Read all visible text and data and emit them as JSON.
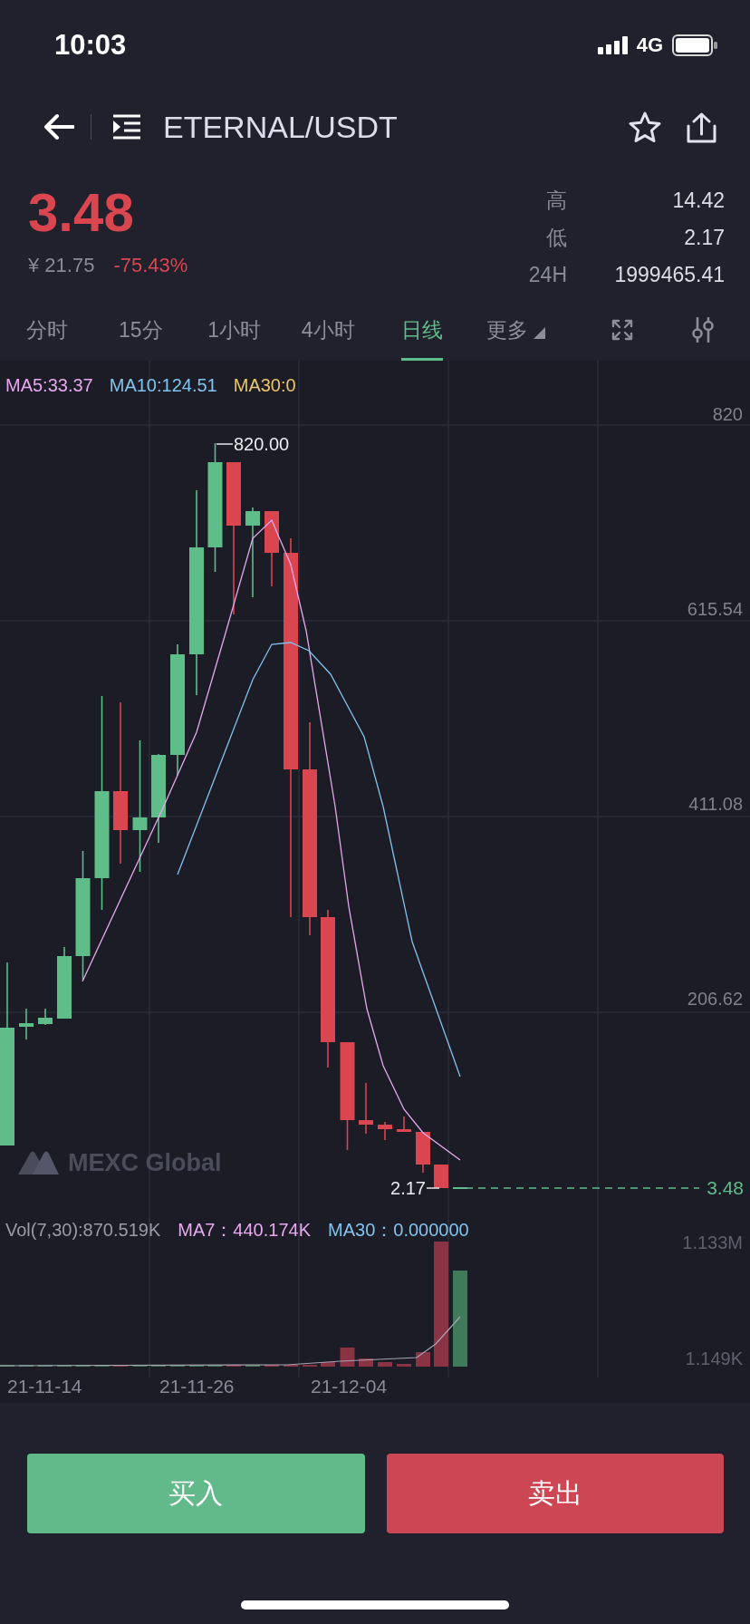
{
  "status_bar": {
    "time": "10:03",
    "network": "4G"
  },
  "nav": {
    "title": "ETERNAL/USDT"
  },
  "ticker": {
    "price": "3.48",
    "falling": true,
    "cny_price": "¥ 21.75",
    "change": "-75.43%",
    "stats": [
      {
        "label": "高",
        "value": "14.42"
      },
      {
        "label": "低",
        "value": "2.17"
      },
      {
        "label": "24H",
        "value": "1999465.41"
      }
    ]
  },
  "intervals": [
    {
      "label": "分时",
      "selected": false,
      "kind": "interval"
    },
    {
      "label": "15分",
      "selected": false,
      "kind": "interval"
    },
    {
      "label": "1小时",
      "selected": false,
      "kind": "interval"
    },
    {
      "label": "4小时",
      "selected": false,
      "kind": "interval"
    },
    {
      "label": "日线",
      "selected": true,
      "kind": "interval"
    },
    {
      "label": "更多",
      "selected": false,
      "kind": "menu"
    }
  ],
  "price_chart": {
    "legend": [
      {
        "label": "MA5:33.37",
        "color": "#e7a9ee"
      },
      {
        "label": "MA10:124.51",
        "color": "#82c3ee"
      },
      {
        "label": "MA30:0",
        "color": "#e9c56d"
      }
    ],
    "axis_labels": [
      "820",
      "615.54",
      "411.08",
      "206.62"
    ],
    "high_label": "820.00",
    "low_label": "2.17",
    "last_price": "3.48",
    "logo": "MEXC Global"
  },
  "volume_chart": {
    "legend": [
      {
        "label": "Vol(7,30):870.519K",
        "color": "#9a9ba6"
      },
      {
        "label": "MA7：440.174K",
        "color": "#e7a9ee"
      },
      {
        "label": "MA30：0.000000",
        "color": "#82c3ee"
      }
    ],
    "axis_labels": [
      "1.133M",
      "1.149K"
    ]
  },
  "dates": [
    "21-11-14",
    "21-11-26",
    "21-12-04"
  ],
  "actions": [
    {
      "label": "买入",
      "kind": "buy"
    },
    {
      "label": "卖出",
      "kind": "sell"
    }
  ]
}
